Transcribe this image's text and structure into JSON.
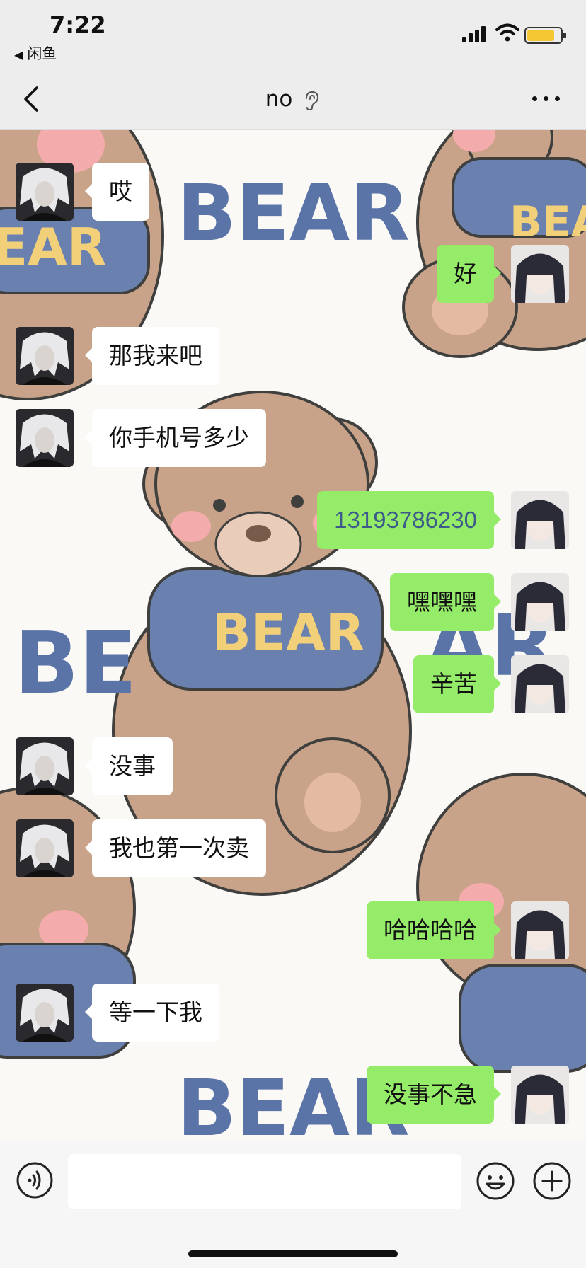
{
  "status_bar": {
    "time": "7:22",
    "back_app": "闲鱼",
    "battery_color": "#f5c730"
  },
  "nav": {
    "title": "no",
    "back_icon": "chevron-left-icon",
    "ear_icon": "ear-icon",
    "more_icon": "more-dots-icon"
  },
  "colors": {
    "my_bubble": "#95ec69",
    "their_bubble": "#ffffff",
    "phone_text": "#3c5a8a"
  },
  "messages": [
    {
      "side": "left",
      "text": "哎"
    },
    {
      "side": "right",
      "text": "好"
    },
    {
      "side": "left",
      "text": "那我来吧"
    },
    {
      "side": "left",
      "text": "你手机号多少"
    },
    {
      "side": "right",
      "text": "13193786230"
    },
    {
      "side": "right",
      "text": "嘿嘿嘿"
    },
    {
      "side": "right",
      "text": "辛苦"
    },
    {
      "side": "left",
      "text": "没事"
    },
    {
      "side": "left",
      "text": "我也第一次卖"
    },
    {
      "side": "right",
      "text": "哈哈哈哈"
    },
    {
      "side": "left",
      "text": "等一下我"
    },
    {
      "side": "right",
      "text": "没事不急"
    }
  ],
  "background": {
    "watermark_texts": [
      "BEAR",
      "BEAR",
      "BE",
      "AR",
      "BEAR",
      "EAR",
      "BEAR"
    ]
  },
  "input_bar": {
    "value": "",
    "voice_icon": "voice-icon",
    "emoji_icon": "emoji-icon",
    "plus_icon": "plus-icon"
  }
}
